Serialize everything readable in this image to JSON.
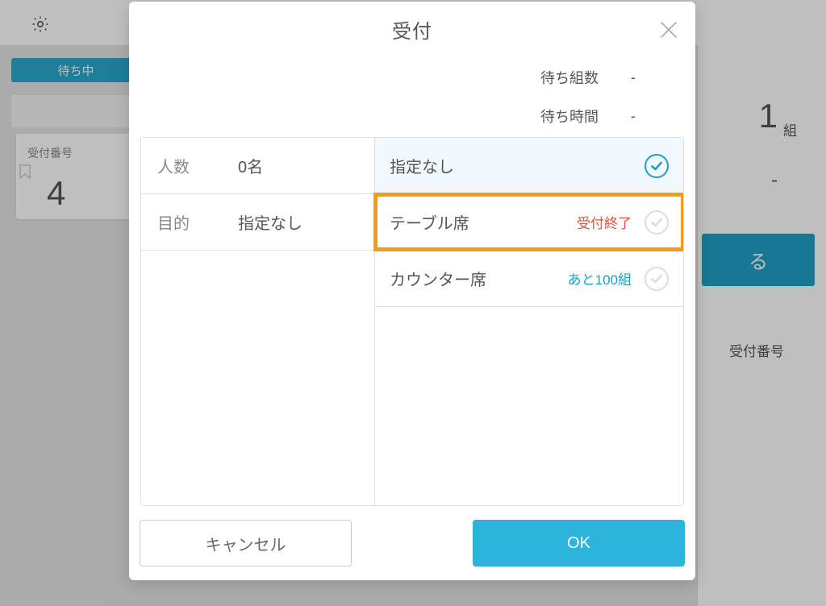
{
  "background": {
    "waiting_tab": "待ち中",
    "ticket_label": "受付番号",
    "ticket_number": "4",
    "count_number": "1",
    "count_unit": "組",
    "dash": "-",
    "blue_btn_visible_char": "る",
    "reception_label": "受付番号"
  },
  "modal": {
    "title": "受付",
    "stats": {
      "groups_label": "待ち組数",
      "groups_value": "-",
      "time_label": "待ち時間",
      "time_value": "-"
    },
    "left": {
      "people_label": "人数",
      "people_value": "0名",
      "purpose_label": "目的",
      "purpose_value": "指定なし"
    },
    "options": [
      {
        "label": "指定なし",
        "status": null,
        "selected": true
      },
      {
        "label": "テーブル席",
        "status_end": "受付終了",
        "selected": false,
        "highlighted": true
      },
      {
        "label": "カウンター席",
        "status_remain": "あと100組",
        "selected": false
      }
    ],
    "buttons": {
      "cancel": "キャンセル",
      "ok": "OK"
    }
  }
}
